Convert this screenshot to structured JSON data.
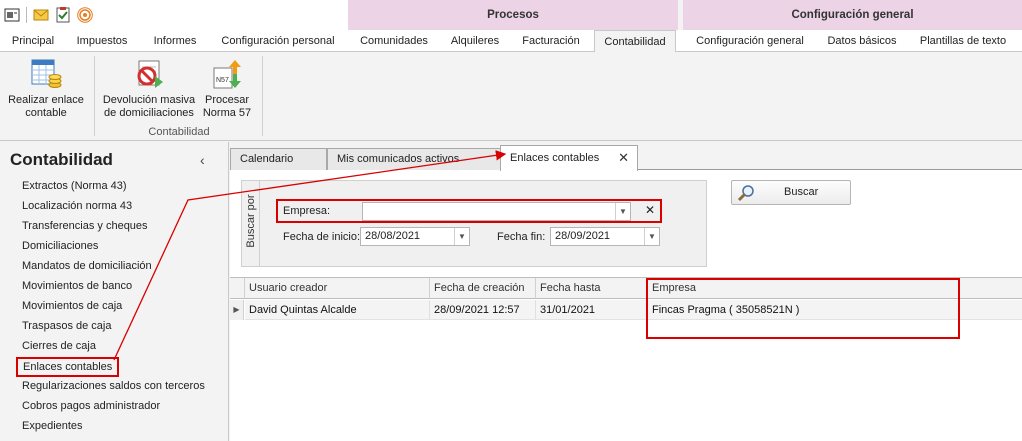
{
  "ribbon": {
    "groups": {
      "procesos": "Procesos",
      "config": "Configuración general"
    },
    "tabs": {
      "principal": "Principal",
      "impuestos": "Impuestos",
      "informes": "Informes",
      "config_personal": "Configuración personal",
      "comunidades": "Comunidades",
      "alquileres": "Alquileres",
      "facturacion": "Facturación",
      "contabilidad": "Contabilidad",
      "config_general": "Configuración general",
      "datos_basicos": "Datos básicos",
      "plantillas": "Plantillas de texto"
    },
    "buttons": {
      "realizar_l1": "Realizar enlace",
      "realizar_l2": "contable",
      "devolucion_l1": "Devolución masiva",
      "devolucion_l2": "de domiciliaciones",
      "procesar_l1": "Procesar",
      "procesar_l2": "Norma 57"
    },
    "group_label": "Contabilidad",
    "n57_badge": "N57"
  },
  "nav": {
    "title": "Contabilidad",
    "collapse": "‹",
    "items": [
      "Extractos (Norma 43)",
      "Localización norma 43",
      "Transferencias y cheques",
      "Domiciliaciones",
      "Mandatos de domiciliación",
      "Movimientos de banco",
      "Movimientos de caja",
      "Traspasos de caja",
      "Cierres de caja",
      "Enlaces contables",
      "Regularizaciones saldos con terceros",
      "Cobros pagos administrador",
      "Expedientes"
    ]
  },
  "doctabs": {
    "calendario": "Calendario",
    "comunicados": "Mis comunicados activos",
    "enlaces": "Enlaces contables",
    "close": "✕"
  },
  "search": {
    "group_label": "Buscar por",
    "empresa_label": "Empresa:",
    "empresa_value": "",
    "fecha_inicio_label": "Fecha de inicio:",
    "fecha_inicio": "28/08/2021",
    "fecha_fin_label": "Fecha fin:",
    "fecha_fin": "28/09/2021",
    "clear": "✕",
    "buscar": "Buscar"
  },
  "grid": {
    "headers": [
      "Usuario creador",
      "Fecha de creación",
      "Fecha hasta",
      "Empresa"
    ],
    "rows": [
      [
        "David Quintas Alcalde",
        "28/09/2021 12:57",
        "31/01/2021",
        "Fincas Pragma ( 35058521N )"
      ]
    ]
  },
  "colors": {
    "highlight": "#d90000",
    "group_band": "#ecd3e6"
  }
}
